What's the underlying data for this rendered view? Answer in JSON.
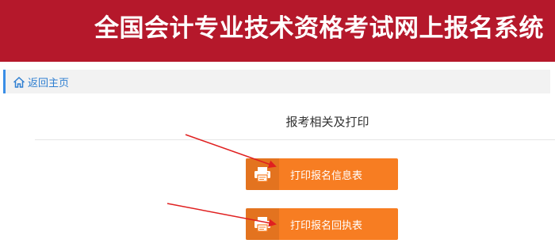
{
  "header": {
    "title": "全国会计专业技术资格考试网上报名系统",
    "bg_color": "#b5182b"
  },
  "breadcrumb": {
    "home_label": "返回主页",
    "home_icon": "home-icon"
  },
  "main": {
    "section_title": "报考相关及打印",
    "buttons": [
      {
        "label": "打印报名信息表",
        "icon": "printer-icon"
      },
      {
        "label": "打印报名回执表",
        "icon": "printer-icon"
      }
    ],
    "button_color": "#f77d22",
    "annotation_color": "#e02020"
  }
}
